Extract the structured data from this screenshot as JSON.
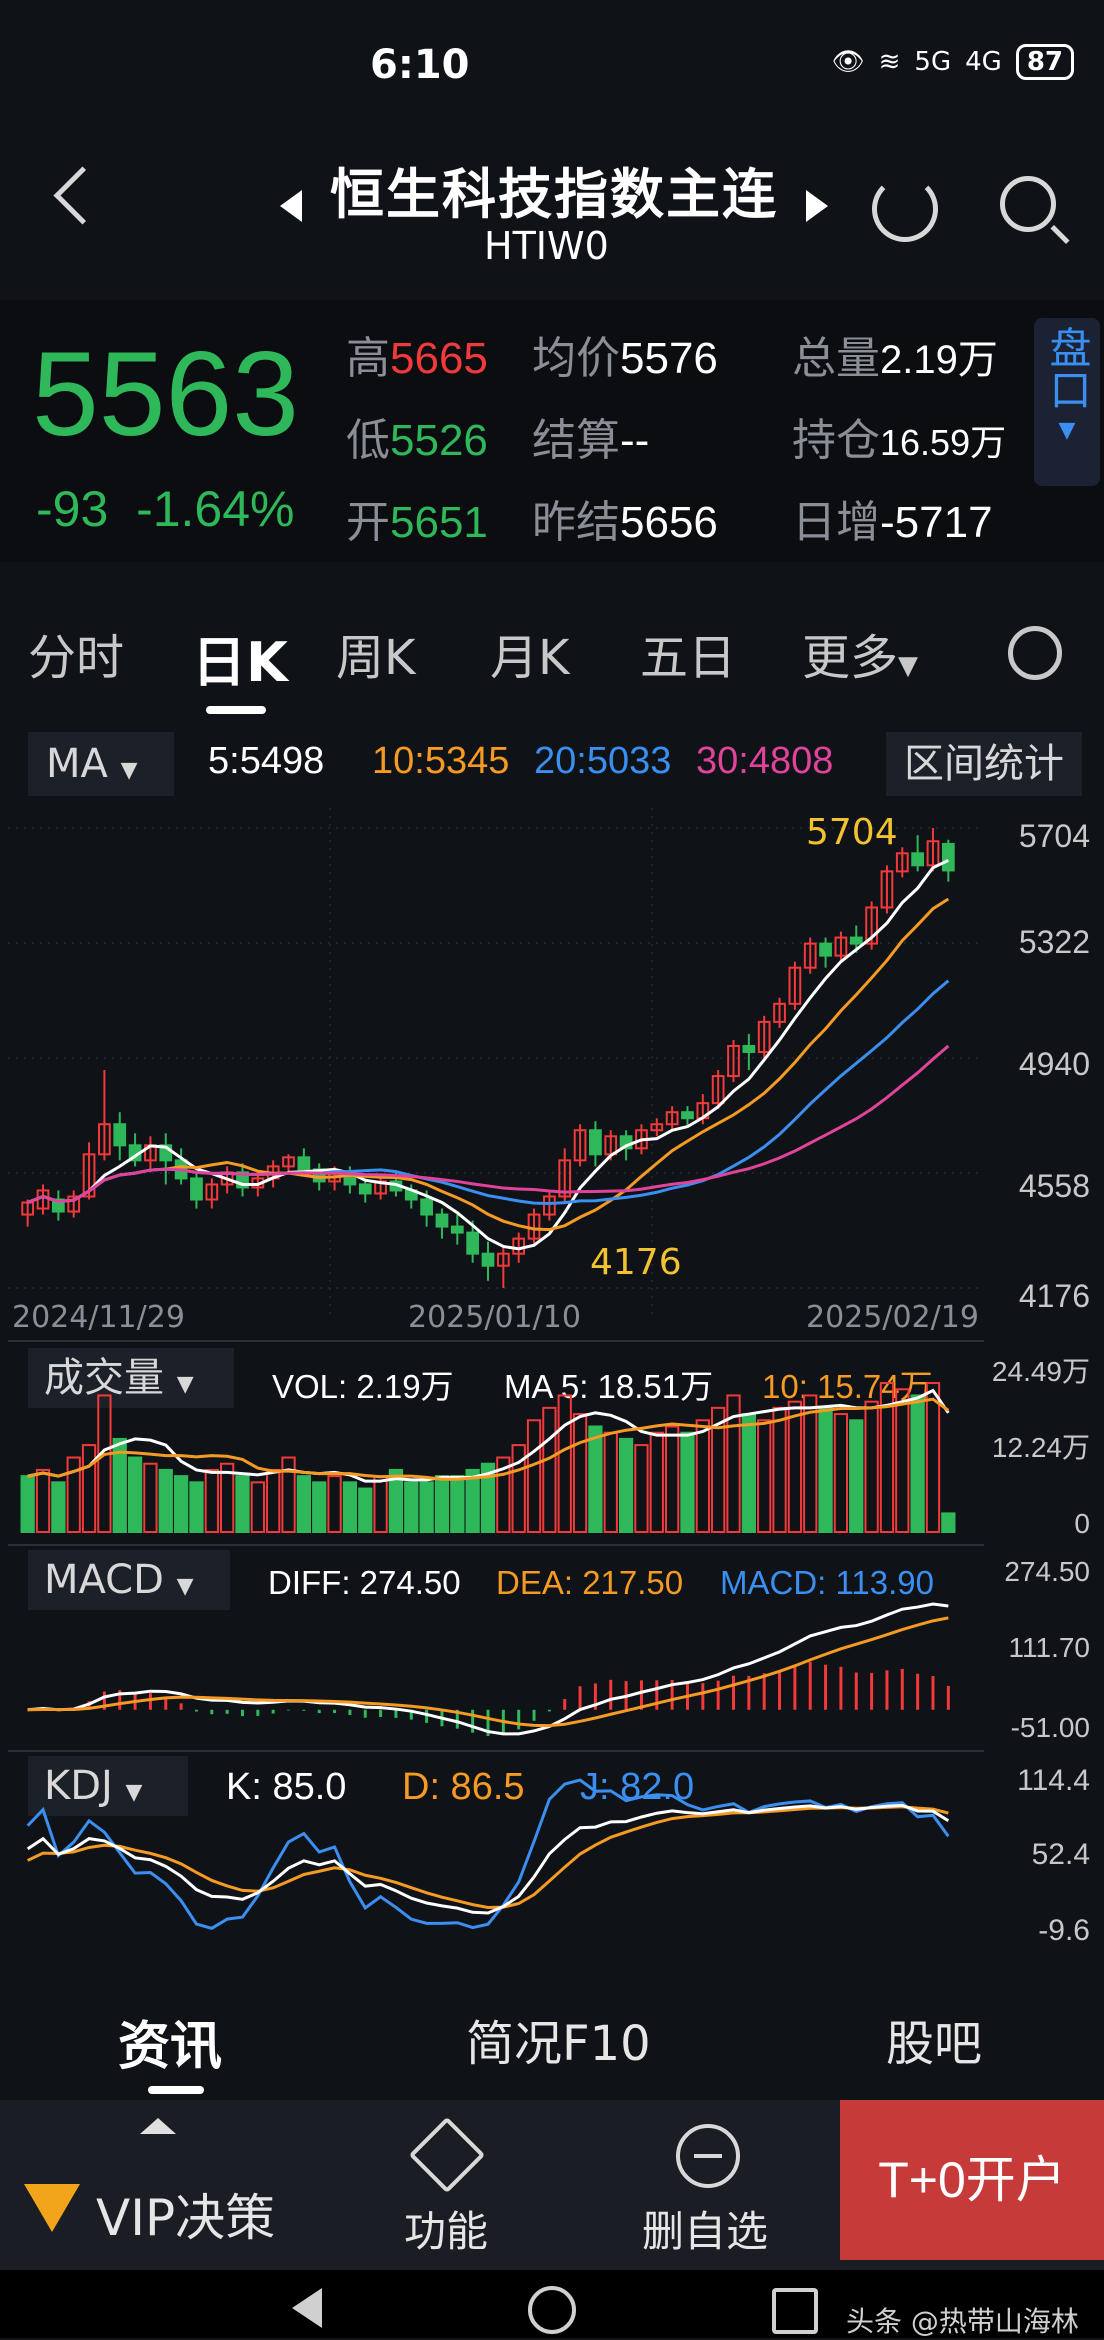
{
  "status_bar": {
    "time": "6:10",
    "battery": "87",
    "signal_1": "5G",
    "signal_2": "4G"
  },
  "header": {
    "title": "恒生科技指数主连",
    "code": "HTIW0"
  },
  "quote": {
    "last_price": "5563",
    "change": "-93",
    "change_pct": "-1.64%",
    "high_label": "高",
    "high": "5665",
    "low_label": "低",
    "low": "5526",
    "open_label": "开",
    "open": "5651",
    "avg_label": "均价",
    "avg": "5576",
    "settle_label": "结算",
    "settle": "--",
    "prev_settle_label": "昨结",
    "prev_settle": "5656",
    "volume_label": "总量",
    "volume": "2.19万",
    "oi_label": "持仓",
    "oi": "16.59万",
    "daily_inc_label": "日增",
    "daily_inc": "-5717",
    "pankou": "盘口"
  },
  "tabs": [
    "分时",
    "日K",
    "周K",
    "月K",
    "五日",
    "更多"
  ],
  "ma_legend": {
    "select": "MA",
    "ma5": "5:5498",
    "ma10": "10:5345",
    "ma20": "20:5033",
    "ma30": "30:4808",
    "range_button": "区间统计"
  },
  "price_chart": {
    "y_ticks": [
      "5704",
      "5322",
      "4940",
      "4558",
      "4176"
    ],
    "dates": [
      "2024/11/29",
      "2025/01/10",
      "2025/02/19"
    ],
    "high_marker": "5704",
    "low_marker": "4176"
  },
  "volume_panel": {
    "select": "成交量",
    "vol": "VOL: 2.19万",
    "ma5": "MA 5: 18.51万",
    "ma10": "10: 15.74万",
    "y_ticks": [
      "24.49万",
      "12.24万",
      "0"
    ]
  },
  "macd_panel": {
    "select": "MACD",
    "diff": "DIFF: 274.50",
    "dea": "DEA: 217.50",
    "macd": "MACD: 113.90",
    "y_ticks": [
      "274.50",
      "111.70",
      "-51.00"
    ]
  },
  "kdj_panel": {
    "select": "KDJ",
    "k": "K: 85.0",
    "d": "D: 86.5",
    "j": "J: 82.0",
    "y_ticks": [
      "114.4",
      "52.4",
      "-9.6"
    ]
  },
  "bottom_tabs": [
    "资讯",
    "简况F10",
    "股吧"
  ],
  "actions": {
    "vip": "VIP决策",
    "functions": "功能",
    "remove": "删自选",
    "open_account": "T+0开户"
  },
  "watermark": "头条 @热带山海林",
  "colors": {
    "up": "#f23a3a",
    "down": "#2fb85a",
    "ma5": "#ffffff",
    "ma10": "#f59a23",
    "ma20": "#3a8ff0",
    "ma30": "#e0449a"
  },
  "chart_data": {
    "type": "candlestick",
    "ylim": [
      4176,
      5704
    ],
    "candles": [
      [
        4420,
        4460,
        4380,
        4470
      ],
      [
        4440,
        4500,
        4420,
        4520
      ],
      [
        4470,
        4430,
        4400,
        4500
      ],
      [
        4430,
        4480,
        4410,
        4500
      ],
      [
        4480,
        4620,
        4470,
        4660
      ],
      [
        4620,
        4720,
        4600,
        4900
      ],
      [
        4720,
        4650,
        4600,
        4760
      ],
      [
        4650,
        4600,
        4580,
        4690
      ],
      [
        4600,
        4650,
        4560,
        4680
      ],
      [
        4650,
        4600,
        4520,
        4690
      ],
      [
        4600,
        4540,
        4520,
        4640
      ],
      [
        4540,
        4470,
        4440,
        4560
      ],
      [
        4470,
        4520,
        4440,
        4540
      ],
      [
        4520,
        4560,
        4490,
        4580
      ],
      [
        4560,
        4510,
        4480,
        4590
      ],
      [
        4510,
        4540,
        4480,
        4560
      ],
      [
        4540,
        4580,
        4510,
        4600
      ],
      [
        4580,
        4610,
        4560,
        4620
      ],
      [
        4610,
        4570,
        4550,
        4640
      ],
      [
        4570,
        4530,
        4500,
        4590
      ],
      [
        4530,
        4560,
        4500,
        4580
      ],
      [
        4560,
        4520,
        4490,
        4580
      ],
      [
        4520,
        4490,
        4460,
        4540
      ],
      [
        4490,
        4530,
        4470,
        4550
      ],
      [
        4530,
        4500,
        4480,
        4560
      ],
      [
        4500,
        4470,
        4440,
        4520
      ],
      [
        4470,
        4420,
        4380,
        4500
      ],
      [
        4420,
        4380,
        4340,
        4440
      ],
      [
        4380,
        4360,
        4320,
        4420
      ],
      [
        4360,
        4290,
        4260,
        4400
      ],
      [
        4290,
        4250,
        4200,
        4330
      ],
      [
        4250,
        4290,
        4176,
        4310
      ],
      [
        4290,
        4340,
        4260,
        4360
      ],
      [
        4340,
        4420,
        4320,
        4440
      ],
      [
        4420,
        4480,
        4400,
        4500
      ],
      [
        4480,
        4600,
        4460,
        4640
      ],
      [
        4600,
        4700,
        4580,
        4720
      ],
      [
        4700,
        4620,
        4580,
        4730
      ],
      [
        4620,
        4680,
        4600,
        4700
      ],
      [
        4680,
        4640,
        4600,
        4700
      ],
      [
        4640,
        4700,
        4620,
        4720
      ],
      [
        4700,
        4720,
        4680,
        4740
      ],
      [
        4720,
        4760,
        4700,
        4780
      ],
      [
        4760,
        4740,
        4710,
        4780
      ],
      [
        4740,
        4790,
        4720,
        4820
      ],
      [
        4790,
        4880,
        4770,
        4900
      ],
      [
        4880,
        4980,
        4860,
        5000
      ],
      [
        4980,
        4960,
        4900,
        5020
      ],
      [
        4960,
        5060,
        4940,
        5080
      ],
      [
        5060,
        5120,
        5040,
        5140
      ],
      [
        5120,
        5240,
        5100,
        5260
      ],
      [
        5240,
        5320,
        5220,
        5340
      ],
      [
        5320,
        5280,
        5240,
        5340
      ],
      [
        5280,
        5340,
        5260,
        5360
      ],
      [
        5340,
        5320,
        5290,
        5380
      ],
      [
        5320,
        5440,
        5300,
        5460
      ],
      [
        5440,
        5560,
        5420,
        5580
      ],
      [
        5560,
        5620,
        5540,
        5640
      ],
      [
        5620,
        5580,
        5560,
        5680
      ],
      [
        5580,
        5660,
        5560,
        5704
      ],
      [
        5651,
        5563,
        5526,
        5665
      ]
    ],
    "volume": [
      9,
      10,
      8,
      12,
      14,
      22,
      15,
      12,
      11,
      10,
      9,
      8,
      10,
      11,
      9,
      8,
      10,
      12,
      9,
      8,
      9,
      8,
      7,
      9,
      10,
      8,
      8,
      9,
      9,
      10,
      11,
      12,
      14,
      18,
      20,
      22,
      19,
      17,
      16,
      15,
      14,
      16,
      17,
      16,
      18,
      20,
      22,
      19,
      18,
      20,
      21,
      22,
      20,
      19,
      18,
      21,
      24,
      23,
      22,
      24,
      3
    ],
    "volume_up": [
      0,
      1,
      0,
      1,
      1,
      1,
      0,
      0,
      1,
      0,
      0,
      0,
      1,
      1,
      0,
      1,
      1,
      1,
      0,
      0,
      1,
      0,
      0,
      1,
      0,
      0,
      0,
      0,
      0,
      0,
      0,
      1,
      1,
      1,
      1,
      1,
      1,
      0,
      1,
      0,
      1,
      1,
      1,
      0,
      1,
      1,
      1,
      0,
      1,
      1,
      1,
      1,
      0,
      1,
      0,
      1,
      1,
      1,
      0,
      1,
      0
    ]
  }
}
